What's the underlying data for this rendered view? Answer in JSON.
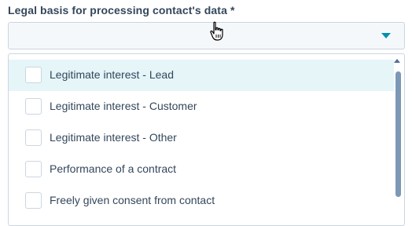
{
  "field": {
    "label": "Legal basis for processing contact's data *",
    "value": ""
  },
  "dropdown": {
    "options": [
      {
        "label": "Legitimate interest - Lead",
        "checked": false,
        "highlighted": true
      },
      {
        "label": "Legitimate interest - Customer",
        "checked": false,
        "highlighted": false
      },
      {
        "label": "Legitimate interest - Other",
        "checked": false,
        "highlighted": false
      },
      {
        "label": "Performance of a contract",
        "checked": false,
        "highlighted": false
      },
      {
        "label": "Freely given consent from contact",
        "checked": false,
        "highlighted": false
      }
    ]
  },
  "colors": {
    "accent": "#0091ae",
    "highlight": "#e5f5f8",
    "text": "#33475b",
    "border": "#cbd6e2"
  },
  "icons": {
    "caret": "caret-down-icon",
    "cursor": "hand-pointer-icon",
    "scroll": "scroll-up-arrow-icon"
  }
}
